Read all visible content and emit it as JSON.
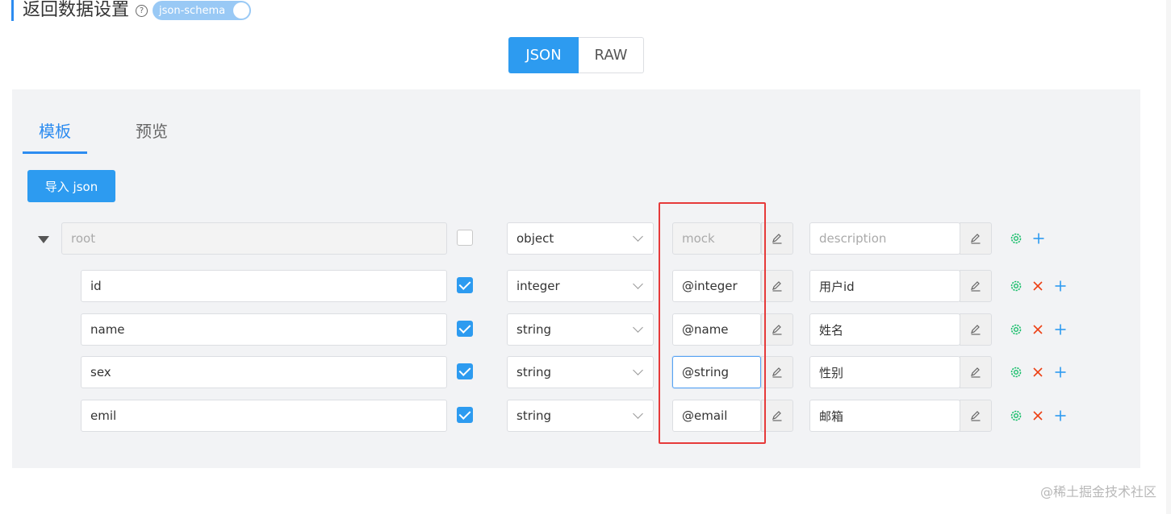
{
  "header": {
    "title": "返回数据设置",
    "help_icon": "?",
    "switch_label": "json-schema"
  },
  "mode_toggle": {
    "json_label": "JSON",
    "raw_label": "RAW",
    "selected": "JSON"
  },
  "tabs": [
    {
      "label": "模板",
      "active": true
    },
    {
      "label": "预览",
      "active": false
    }
  ],
  "import_button": "导入 json",
  "schema": {
    "root": {
      "name": "root",
      "type": "object",
      "mock_placeholder": "mock",
      "description_placeholder": "description",
      "required": false
    },
    "fields": [
      {
        "name": "id",
        "required": true,
        "type": "integer",
        "mock": "@integer",
        "description": "用户id"
      },
      {
        "name": "name",
        "required": true,
        "type": "string",
        "mock": "@name",
        "description": "姓名"
      },
      {
        "name": "sex",
        "required": true,
        "type": "string",
        "mock": "@string",
        "description": "性别"
      },
      {
        "name": "emil",
        "required": true,
        "type": "string",
        "mock": "@email",
        "description": "邮箱"
      }
    ]
  },
  "watermark": "@稀土掘金技术社区",
  "colors": {
    "primary": "#2d9bf0",
    "gear": "#19be6b",
    "delete": "#ed4014",
    "highlight_border": "#e63a3a"
  }
}
